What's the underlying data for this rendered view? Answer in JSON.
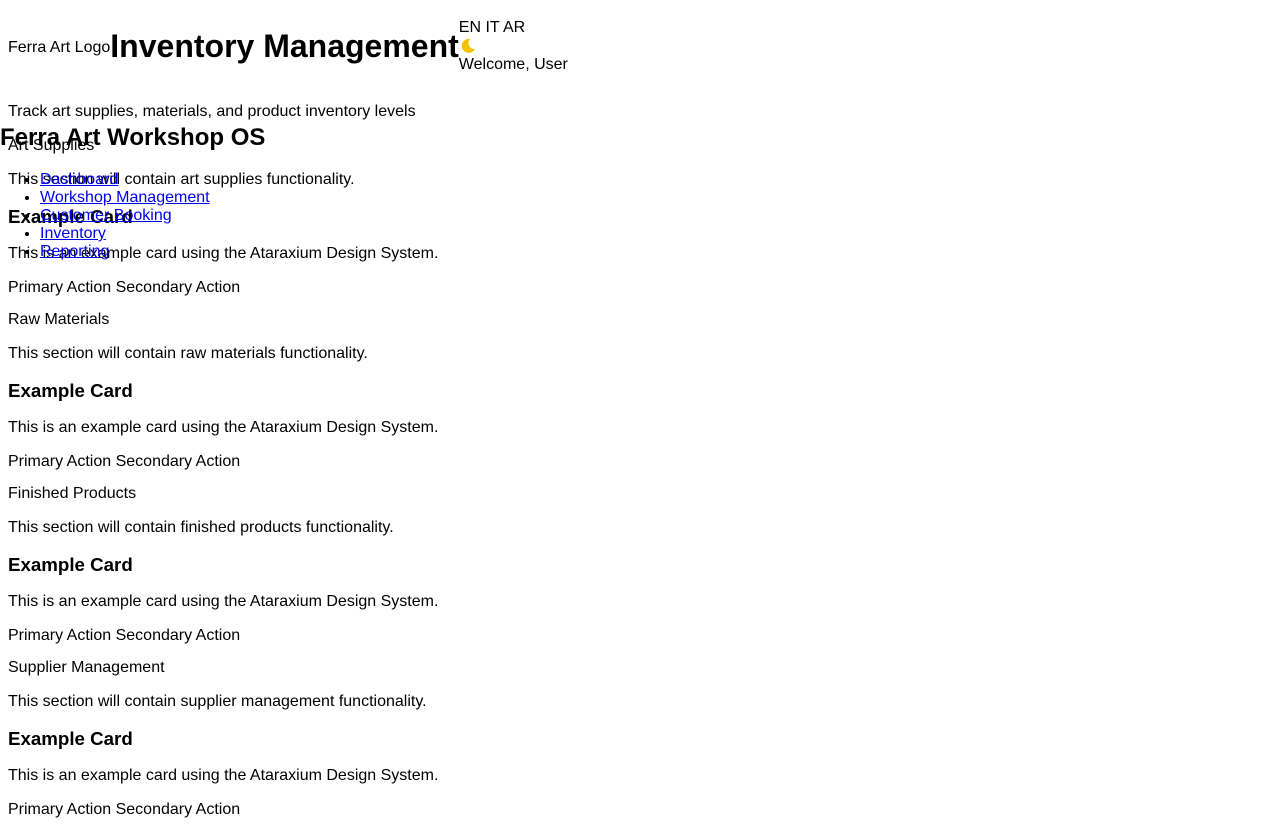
{
  "header": {
    "logo_alt": "Ferra Art Logo",
    "title": "Inventory Management",
    "languages": [
      "EN",
      "IT",
      "AR"
    ],
    "theme_toggle_icon": "moon-icon",
    "welcome": "Welcome, User"
  },
  "subtitle": "Track art supplies, materials, and product inventory levels",
  "nav": {
    "brand": "Ferra Art Workshop OS",
    "items": [
      "Dashboard",
      "Workshop Management",
      "Customer Booking",
      "Inventory",
      "Reporting"
    ]
  },
  "sections": [
    {
      "title": "Art Supplies",
      "desc": "This section will contain art supplies functionality.",
      "card_title": "Example Card",
      "card_text": "This is an example card using the Ataraxium Design System.",
      "primary": "Primary Action",
      "secondary": "Secondary Action"
    },
    {
      "title": "Raw Materials",
      "desc": "This section will contain raw materials functionality.",
      "card_title": "Example Card",
      "card_text": "This is an example card using the Ataraxium Design System.",
      "primary": "Primary Action",
      "secondary": "Secondary Action"
    },
    {
      "title": "Finished Products",
      "desc": "This section will contain finished products functionality.",
      "card_title": "Example Card",
      "card_text": "This is an example card using the Ataraxium Design System.",
      "primary": "Primary Action",
      "secondary": "Secondary Action"
    },
    {
      "title": "Supplier Management",
      "desc": "This section will contain supplier management functionality.",
      "card_title": "Example Card",
      "card_text": "This is an example card using the Ataraxium Design System.",
      "primary": "Primary Action",
      "secondary": "Secondary Action"
    }
  ]
}
